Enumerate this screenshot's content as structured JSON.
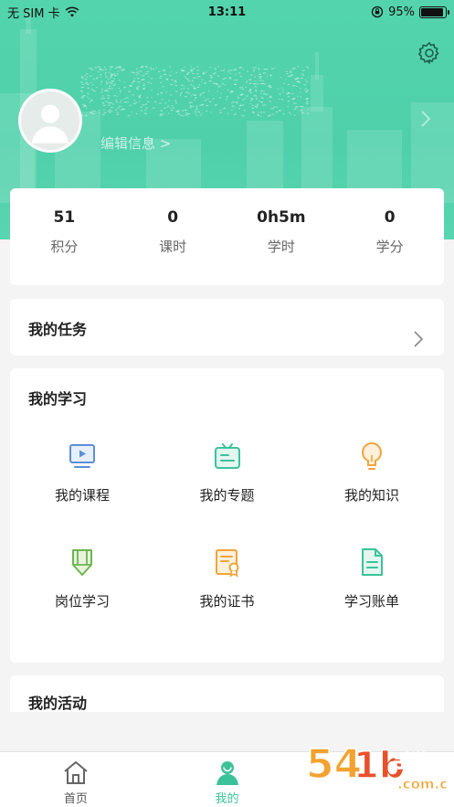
{
  "status_bar": {
    "carrier": "无 SIM 卡",
    "time": "13:11",
    "battery": "95%"
  },
  "profile": {
    "edit_label": "编辑信息 >"
  },
  "stats": [
    {
      "value": "51",
      "label": "积分"
    },
    {
      "value": "0",
      "label": "课时"
    },
    {
      "value": "0h5m",
      "label": "学时"
    },
    {
      "value": "0",
      "label": "学分"
    }
  ],
  "task": {
    "title": "我的任务"
  },
  "study": {
    "title": "我的学习",
    "items": [
      {
        "label": "我的课程",
        "icon": "video-course-icon"
      },
      {
        "label": "我的专题",
        "icon": "topic-icon"
      },
      {
        "label": "我的知识",
        "icon": "lightbulb-icon"
      },
      {
        "label": "岗位学习",
        "icon": "pencil-icon"
      },
      {
        "label": "我的证书",
        "icon": "certificate-icon"
      },
      {
        "label": "学习账单",
        "icon": "bill-document-icon"
      }
    ]
  },
  "activity": {
    "title": "我的活动"
  },
  "tabs": [
    {
      "label": "首页",
      "icon": "home-icon"
    },
    {
      "label": "我的",
      "icon": "user-icon"
    }
  ],
  "watermark": {
    "text": "54游手游网",
    "url": ".com.cn"
  },
  "colors": {
    "accent": "#3cc29a",
    "header": "#53d4ac",
    "blue": "#5b8fd6",
    "orange": "#f0a43c"
  }
}
